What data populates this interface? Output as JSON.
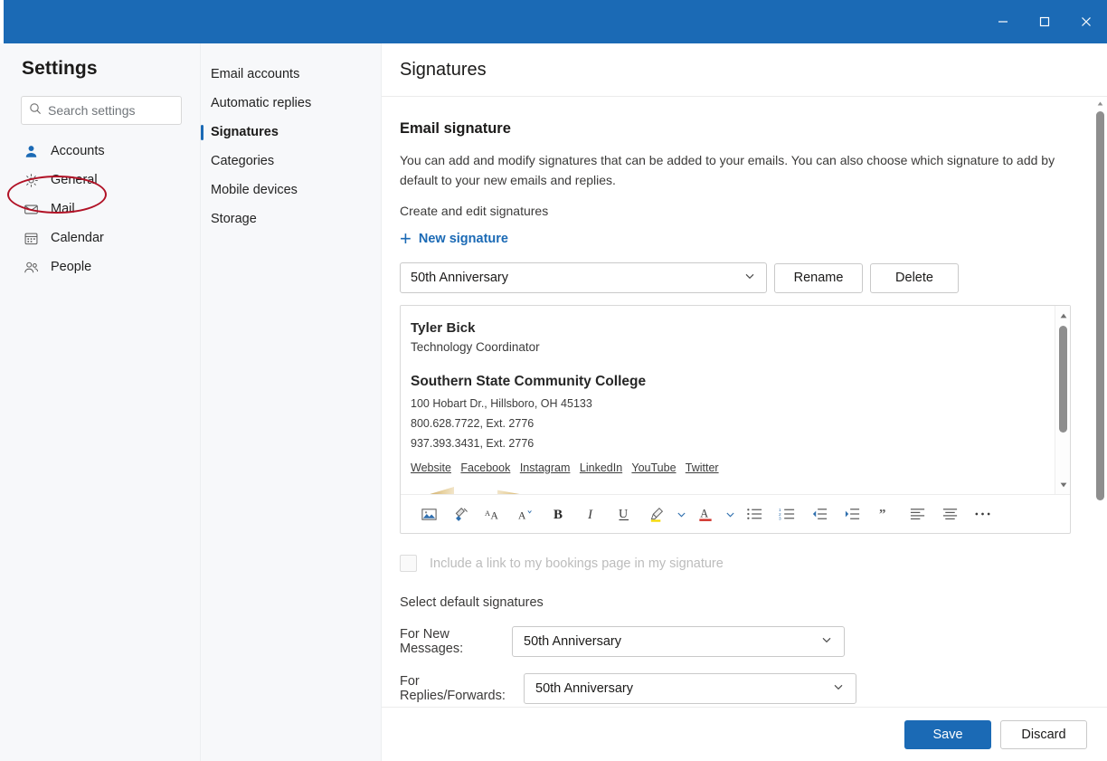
{
  "titlebar": {
    "minimize_label": "Minimize",
    "maximize_label": "Maximize",
    "close_label": "Close",
    "accent_color": "#1b6ab5"
  },
  "sidebar": {
    "title": "Settings",
    "search": {
      "placeholder": "Search settings",
      "value": "",
      "icon": "search-icon"
    },
    "items": [
      {
        "label": "Accounts",
        "icon": "person-icon",
        "selected": true
      },
      {
        "label": "General",
        "icon": "gear-icon",
        "selected": false
      },
      {
        "label": "Mail",
        "icon": "envelope-icon",
        "selected": false
      },
      {
        "label": "Calendar",
        "icon": "calendar-icon",
        "selected": false
      },
      {
        "label": "People",
        "icon": "people-icon",
        "selected": false
      }
    ]
  },
  "subnav": {
    "items": [
      {
        "label": "Email accounts",
        "selected": false
      },
      {
        "label": "Automatic replies",
        "selected": false
      },
      {
        "label": "Signatures",
        "selected": true
      },
      {
        "label": "Categories",
        "selected": false
      },
      {
        "label": "Mobile devices",
        "selected": false
      },
      {
        "label": "Storage",
        "selected": false
      }
    ]
  },
  "main": {
    "page_title": "Signatures",
    "section_title": "Email signature",
    "description": "You can add and modify signatures that can be added to your emails. You can also choose which signature to add by default to your new emails and replies.",
    "create_label": "Create and edit signatures",
    "new_signature_label": "New signature",
    "new_signature_plus": "+",
    "signature_select": {
      "value": "50th Anniversary",
      "chevron": "chevron-down-icon"
    },
    "rename_label": "Rename",
    "delete_label": "Delete"
  },
  "signature_editor": {
    "name": "Tyler Bick",
    "role": "Technology Coordinator",
    "organization": "Southern State Community College",
    "address": "100 Hobart Dr., Hillsboro, OH  45133",
    "phone1": "800.628.7722, Ext. 2776",
    "phone2": "937.393.3431, Ext. 2776",
    "links": [
      "Website",
      "Facebook",
      "Instagram",
      "LinkedIn",
      "YouTube",
      "Twitter"
    ]
  },
  "toolbar": {
    "items": [
      {
        "name": "insert-picture-icon",
        "glyph": "picture"
      },
      {
        "name": "format-painter-icon",
        "glyph": "brush"
      },
      {
        "name": "grow-font-icon",
        "glyph": "AA-up"
      },
      {
        "name": "shrink-font-icon",
        "glyph": "A-down"
      },
      {
        "name": "bold-icon",
        "glyph": "B"
      },
      {
        "name": "italic-icon",
        "glyph": "I"
      },
      {
        "name": "underline-icon",
        "glyph": "U"
      },
      {
        "name": "highlight-icon",
        "glyph": "highlighter"
      },
      {
        "name": "highlight-chevron-icon",
        "glyph": "chevron"
      },
      {
        "name": "font-color-icon",
        "glyph": "A-color"
      },
      {
        "name": "font-color-chevron-icon",
        "glyph": "chevron"
      },
      {
        "name": "bulleted-list-icon",
        "glyph": "bullets"
      },
      {
        "name": "numbered-list-icon",
        "glyph": "numbers"
      },
      {
        "name": "decrease-indent-icon",
        "glyph": "outdent"
      },
      {
        "name": "increase-indent-icon",
        "glyph": "indent"
      },
      {
        "name": "quote-icon",
        "glyph": "quote"
      },
      {
        "name": "align-left-icon",
        "glyph": "align-left"
      },
      {
        "name": "align-center-icon",
        "glyph": "align-center"
      },
      {
        "name": "more-options-icon",
        "glyph": "ellipsis"
      }
    ]
  },
  "bookings": {
    "label": "Include a link to my bookings page in my signature",
    "checked": false,
    "disabled": true
  },
  "defaults": {
    "title": "Select default signatures",
    "new_messages_label": "For New Messages:",
    "new_messages_value": "50th Anniversary",
    "replies_label": "For Replies/Forwards:",
    "replies_value": "50th Anniversary"
  },
  "footer": {
    "save_label": "Save",
    "discard_label": "Discard"
  },
  "annotations": {
    "color": "#b11226",
    "marks": [
      "accounts-ellipse",
      "signatures-ellipse"
    ]
  }
}
